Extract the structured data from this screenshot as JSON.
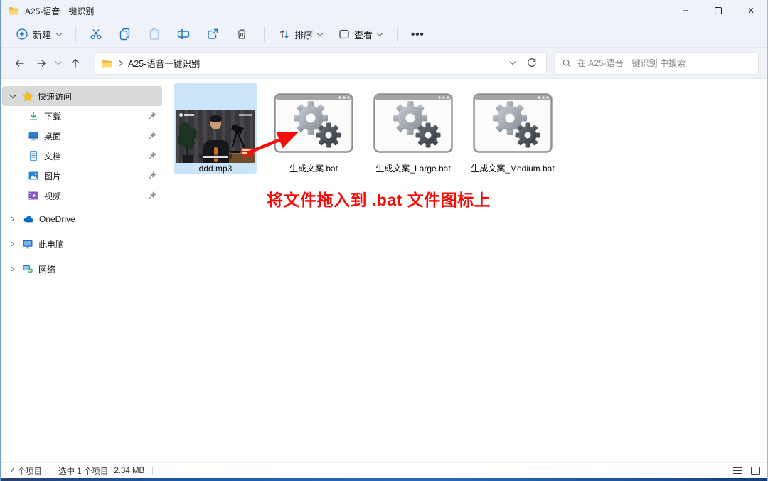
{
  "window": {
    "title": "A25-语音一键识别",
    "minimize_glyph": "─",
    "close_glyph": "✕"
  },
  "toolbar": {
    "new_label": "新建",
    "sort_label": "排序",
    "view_label": "查看",
    "more_glyph": "•••"
  },
  "address_bar": {
    "folder_name": "A25-语音一键识别",
    "search_placeholder": "在 A25-语音一键识别 中搜索"
  },
  "sidebar": {
    "quick_access_label": "快速访问",
    "quick_items": [
      {
        "label": "下载",
        "icon": "download-icon",
        "pinned": true
      },
      {
        "label": "桌面",
        "icon": "desktop-icon",
        "pinned": true
      },
      {
        "label": "文档",
        "icon": "document-icon",
        "pinned": true
      },
      {
        "label": "图片",
        "icon": "pictures-icon",
        "pinned": true
      },
      {
        "label": "视频",
        "icon": "videos-icon",
        "pinned": true
      }
    ],
    "tree_items": [
      {
        "label": "OneDrive",
        "icon": "onedrive-cloud-icon"
      },
      {
        "label": "此电脑",
        "icon": "this-pc-icon"
      },
      {
        "label": "网络",
        "icon": "network-icon"
      }
    ]
  },
  "files": [
    {
      "name": "ddd.mp3",
      "type": "mp3-video-thumbnail",
      "selected": true
    },
    {
      "name": "生成文案.bat",
      "type": "batch-file",
      "selected": false
    },
    {
      "name": "生成文案_Large.bat",
      "type": "batch-file",
      "selected": false
    },
    {
      "name": "生成文案_Medium.bat",
      "type": "batch-file",
      "selected": false
    }
  ],
  "annotation": {
    "text": "将文件拖入到 .bat 文件图标上",
    "color": "#fb0705",
    "arrow": "red arrow pointing from ddd.mp3 thumbnail to 生成文案.bat icon"
  },
  "status_bar": {
    "total": "4 个项目",
    "selected": "选中 1 个项目",
    "size": "2.34 MB"
  },
  "colors": {
    "chrome_bg": "#eff3f9",
    "selection_bg": "#cce4f7",
    "quick_access_row": "#d9d9d9",
    "accent_blue": "#1e74c4",
    "annotation_red": "#fb0705"
  }
}
